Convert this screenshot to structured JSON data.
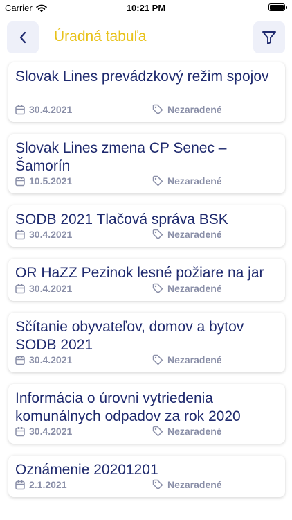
{
  "status_bar": {
    "carrier": "Carrier",
    "time": "10:21 PM"
  },
  "nav": {
    "title": "Úradná tabuľa"
  },
  "items": [
    {
      "title": "Slovak Lines prevádzkový režim spojov",
      "date": "30.4.2021",
      "tag": "Nezaradené"
    },
    {
      "title": "Slovak Lines zmena CP Senec – Šamorín",
      "date": "10.5.2021",
      "tag": "Nezaradené"
    },
    {
      "title": "SODB 2021 Tlačová správa BSK",
      "date": "30.4.2021",
      "tag": "Nezaradené"
    },
    {
      "title": "OR HaZZ Pezinok lesné požiare na jar",
      "date": "30.4.2021",
      "tag": "Nezaradené"
    },
    {
      "title": "Sčítanie obyvateľov, domov a bytov SODB 2021",
      "date": "30.4.2021",
      "tag": "Nezaradené"
    },
    {
      "title": "Informácia o úrovni vytriedenia komunálnych odpadov za rok 2020",
      "date": "30.4.2021",
      "tag": "Nezaradené"
    },
    {
      "title": "Oznámenie 20201201",
      "date": "2.1.2021",
      "tag": "Nezaradené"
    }
  ]
}
